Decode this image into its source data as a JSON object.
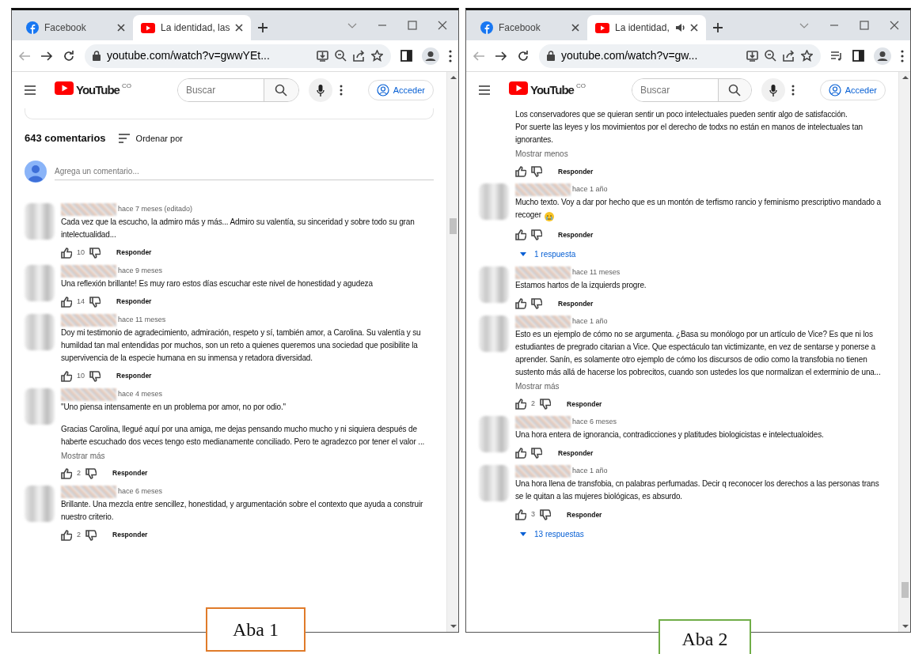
{
  "panels": [
    {
      "label": "Aba 1",
      "tabs": [
        {
          "title": "Facebook",
          "selected": false,
          "audio_playing": false
        },
        {
          "title": "La identidad, las",
          "selected": true,
          "audio_playing": false
        }
      ],
      "url": "youtube.com/watch?v=gwwYEt...",
      "media_control_visible": false,
      "youtube": {
        "logo": "YouTube",
        "search_placeholder": "Buscar",
        "region": "CO",
        "sign_in": "Acceder"
      },
      "description_card_visible": true,
      "comments_header": {
        "count": "643 comentarios",
        "sort": "Ordenar por",
        "add_placeholder": "Agrega un comentario..."
      },
      "comments": [
        {
          "time": "hace 7 meses (editado)",
          "paragraphs": [
            "Cada vez que la escucho, la admiro más y más... Admiro su valentía, su sinceridad y sobre todo su gran intelectualidad..."
          ],
          "likes": "10",
          "reply": "Responder"
        },
        {
          "time": "hace 9 meses",
          "paragraphs": [
            "Una reflexión brillante! Es muy raro estos días escuchar este nivel de honestidad y agudeza"
          ],
          "likes": "14",
          "reply": "Responder"
        },
        {
          "time": "hace 11 meses",
          "paragraphs": [
            "Doy mi testimonio de agradecimiento, admiración, respeto y sí, también amor, a Carolina. Su valentía y su humildad tan mal entendidas por muchos, son un reto a quienes queremos una sociedad que posibilite la supervivencia de la especie humana en su inmensa y retadora diversidad."
          ],
          "likes": "10",
          "reply": "Responder"
        },
        {
          "time": "hace 4 meses",
          "paragraphs": [
            "\"Uno piensa intensamente en un problema por amor, no por odio.\"",
            "Gracias Carolina, llegué aquí por una amiga, me dejas pensando mucho mucho y ni siquiera  después de haberte escuchado dos veces tengo esto medianamente conciliado. Pero te agradezco por tener el valor ..."
          ],
          "toggle": "Mostrar más",
          "likes": "2",
          "reply": "Responder"
        },
        {
          "time": "hace 6 meses",
          "paragraphs": [
            "Brillante. Una mezcla entre sencillez, honestidad, y argumentación sobre el contexto que ayuda a  construir nuestro criterio."
          ],
          "likes": "2",
          "reply": "Responder"
        }
      ]
    },
    {
      "label": "Aba 2",
      "tabs": [
        {
          "title": "Facebook",
          "selected": false,
          "audio_playing": false
        },
        {
          "title": "La identidad,",
          "selected": true,
          "audio_playing": true
        }
      ],
      "url": "youtube.com/watch?v=gw...",
      "media_control_visible": true,
      "youtube": {
        "logo": "YouTube",
        "search_placeholder": "Buscar",
        "region": "CO",
        "sign_in": "Acceder"
      },
      "description_card_visible": false,
      "comments": [
        {
          "paragraphs": [
            "Los conservadores que se quieran sentir un poco intelectuales pueden sentir algo de satisfacción.\nPor suerte las leyes y los movimientos por el derecho de todxs no están en manos de intelectuales tan ignorantes."
          ],
          "toggle": "Mostrar menos",
          "reply": "Responder"
        },
        {
          "time": "hace 1 año",
          "paragraphs": [
            "Mucho texto. Voy a dar por hecho que es un montón de terfismo rancio y feminismo prescriptivo mandado a recoger"
          ],
          "emoji_crying": true,
          "reply": "Responder",
          "replies": "1 respuesta"
        },
        {
          "time": "hace 11 meses",
          "paragraphs": [
            "Estamos hartos de la izquierds progre."
          ],
          "reply": "Responder"
        },
        {
          "time": "hace 1 año",
          "paragraphs": [
            "Esto es un ejemplo de cómo no se argumenta. ¿Basa su monólogo por un artículo de Vice? Es que ni los estudiantes de pregrado citarian a Vice. Que espectáculo tan victimizante, en vez de sentarse y ponerse a aprender. Sanín, es solamente otro ejemplo de cómo los discursos de odio como la transfobia no tienen sustento más allá de hacerse los pobrecitos, cuando son ustedes los que normalizan el exterminio de una..."
          ],
          "toggle": "Mostrar más",
          "likes": "2",
          "reply": "Responder"
        },
        {
          "time": "hace 6 meses",
          "paragraphs": [
            "Una hora entera de ignorancia, contradicciones y platitudes biologicistas e intelectualoides."
          ],
          "reply": "Responder"
        },
        {
          "time": "hace 1 año",
          "paragraphs": [
            "Una hora llena de transfobia, cn palabras perfumadas. Decir q reconocer los derechos a las personas trans se le quitan a las mujeres biológicas, es absurdo."
          ],
          "likes": "3",
          "reply": "Responder",
          "replies": "13 respuestas"
        }
      ]
    }
  ]
}
